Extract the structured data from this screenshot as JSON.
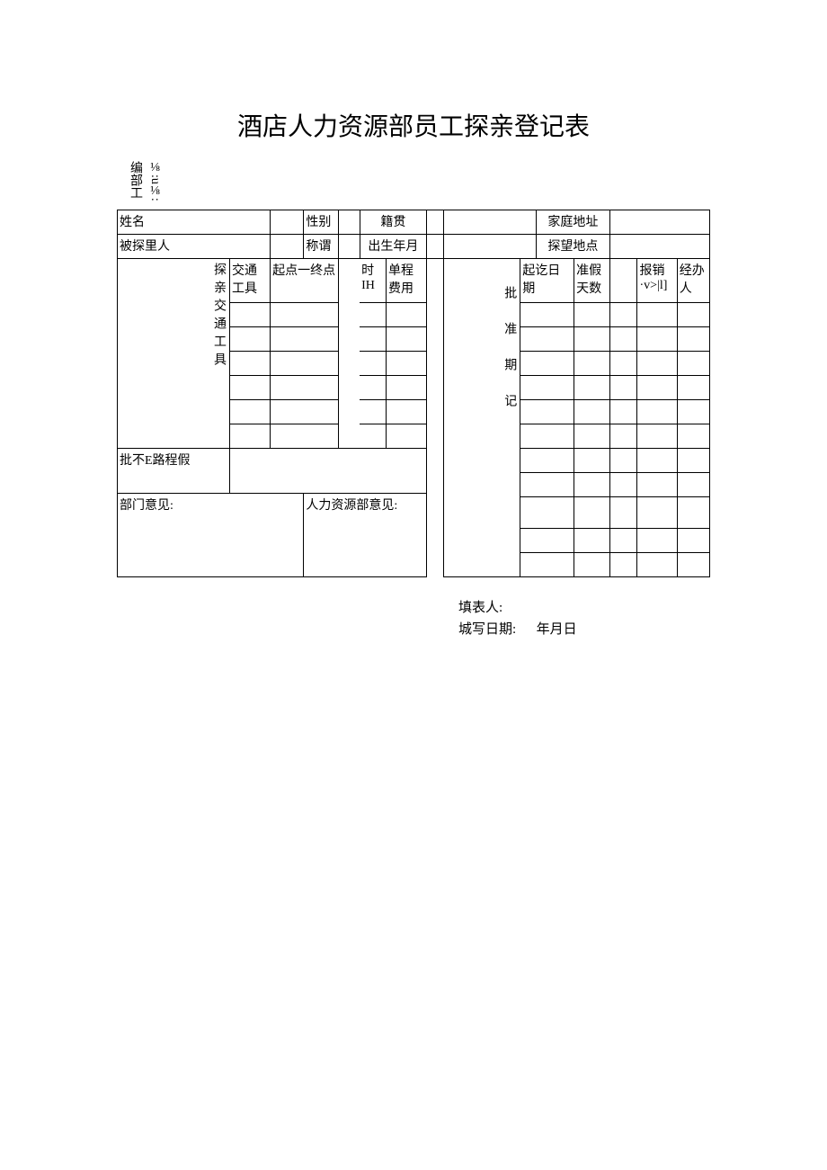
{
  "title": "酒店人力资源部员工探亲登记表",
  "preheader": {
    "col1": "编部工",
    "col2": "⅛:u⅛:"
  },
  "row1": {
    "name_lab": "姓名",
    "gender_lab": "性别",
    "native_lab": "籍贯",
    "addr_lab": "家庭地址"
  },
  "row2": {
    "visitee_lab": "被探里人",
    "relation_lab": "称谓",
    "dob_lab": "出生年月",
    "visitplace_lab": "探望地点"
  },
  "transport": {
    "side_lab": "探亲交通工具",
    "tool_lab": "交通工具",
    "route_lab": "起点一终点",
    "time_lab": "时\nIH",
    "fare_lab": "单程费用"
  },
  "approve_lab": "批不E路程假",
  "dept_opinion_lab": "部门意见:",
  "hr_opinion_lab": "人力资源部意见:",
  "right": {
    "side_lab": "批准期记",
    "dates_lab": "起讫日期",
    "days_lab": "准假天数",
    "reimburse_lab": "报销·v>|l]",
    "handler_lab": "经办人"
  },
  "footer": {
    "filler_lab": "填表人:",
    "date_lab": "城写日期:",
    "date_val": "年月日"
  }
}
